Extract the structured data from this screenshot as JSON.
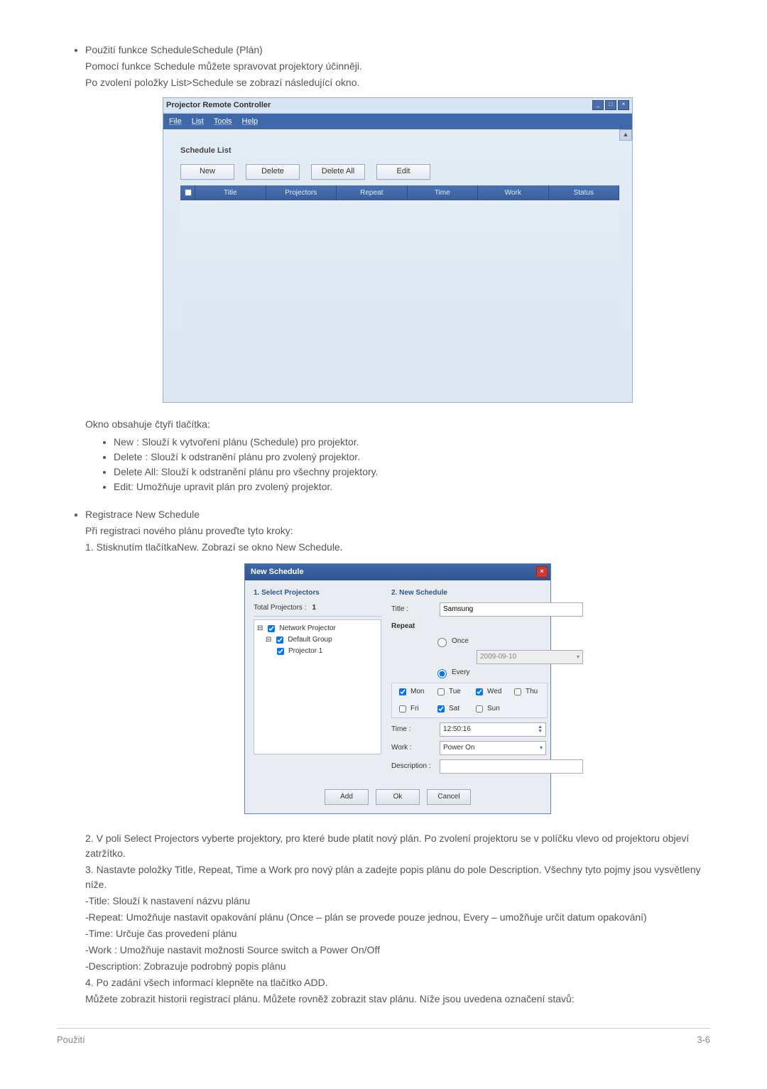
{
  "doc": {
    "bullet_heading_1": "Použití funkce ScheduleSchedule (Plán)",
    "para_1a": "Pomocí funkce Schedule můžete spravovat projektory účinněji.",
    "para_1b": "Po zvolení položky  List>Schedule se zobrazí následující okno.",
    "para_2": "Okno obsahuje čtyři tlačítka:",
    "btn_list": {
      "new": " New : Slouží k vytvoření plánu (Schedule) pro projektor.",
      "delete": "Delete : Slouží k odstranění plánu pro zvolený projektor.",
      "deleteAll": "Delete All: Slouží k odstranění plánu pro všechny projektory.",
      "edit": "Edit: Umožňuje upravit plán pro zvolený projektor."
    },
    "bullet_heading_2": "Registrace New Schedule",
    "para_3a": "Při registraci nového plánu proveďte tyto kroky:",
    "para_3b": "1. Stisknutím tlačítkaNew. Zobrazí se okno  New Schedule.",
    "para_4": "2. V poli Select Projectors vyberte projektory, pro které bude platit nový plán. Po zvolení projektoru se v políčku vlevo od projektoru objeví zatržítko.",
    "para_5": "3. Nastavte položky Title, Repeat, Time a Work pro nový plán a zadejte popis plánu do pole Description. Všechny tyto pojmy jsou vysvětleny níže.",
    "para_6": "-Title: Slouží k nastavení názvu plánu",
    "para_7": "-Repeat: Umožňuje nastavit opakování plánu (Once – plán se provede pouze jednou, Every – umožňuje určit datum opakování)",
    "para_8": "-Time: Určuje čas provedení plánu",
    "para_9": "-Work : Umožňuje nastavit možnosti Source switch a Power On/Off",
    "para_10": "-Description: Zobrazuje podrobný popis plánu",
    "para_11": "4. Po zadání všech informací klepněte na tlačítko ADD.",
    "para_12": "Můžete zobrazit historii registrací plánu. Můžete rovněž zobrazit stav plánu. Níže jsou uvedena označení stavů:",
    "footer_left": "Použití",
    "footer_right": "3-6"
  },
  "app1": {
    "title": "Projector Remote Controller",
    "menu": {
      "file": "File",
      "list": "List",
      "tools": "Tools",
      "help": "Help"
    },
    "panel_title": "Schedule List",
    "buttons": {
      "new": "New",
      "delete": "Delete",
      "deleteAll": "Delete All",
      "edit": "Edit"
    },
    "columns": {
      "c1": "Title",
      "c2": "Projectors",
      "c3": "Repeat",
      "c4": "Time",
      "c5": "Work",
      "c6": "Status"
    }
  },
  "app2": {
    "title": "New Schedule",
    "left": {
      "heading": "1. Select Projectors",
      "total_label": "Total Projectors :",
      "total_value": "1",
      "tree": {
        "root": "Network Projector",
        "group": "Default Group",
        "projector": "Projector 1"
      }
    },
    "right": {
      "heading": "2. New Schedule",
      "title_label": "Title :",
      "title_value": "Samsung",
      "repeat_label": "Repeat",
      "once_label": "Once",
      "every_label": "Every",
      "date_value": "2009-09-10",
      "days": {
        "mon": "Mon",
        "tue": "Tue",
        "wed": "Wed",
        "thu": "Thu",
        "fri": "Fri",
        "sat": "Sat",
        "sun": "Sun"
      },
      "time_label": "Time :",
      "time_value": "12:50:16",
      "work_label": "Work :",
      "work_value": "Power On",
      "desc_label": "Description :"
    },
    "footer": {
      "add": "Add",
      "ok": "Ok",
      "cancel": "Cancel"
    }
  }
}
